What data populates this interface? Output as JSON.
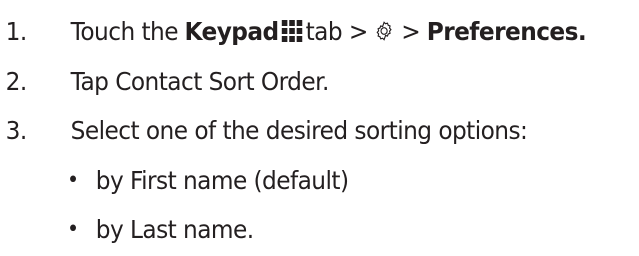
{
  "steps": [
    {
      "number": "1.",
      "parts": {
        "a": "Touch the",
        "b": "Keypad",
        "c": "tab >",
        "d": ">",
        "e": "Preferences."
      }
    },
    {
      "number": "2.",
      "text": "Tap Contact Sort Order."
    },
    {
      "number": "3.",
      "text": "Select one of the desired sorting options:"
    }
  ],
  "options": [
    {
      "bullet": "•",
      "text": "by First name (default)"
    },
    {
      "bullet": "•",
      "text": "by Last name."
    }
  ],
  "icons": {
    "keypad": "keypad-grid-icon",
    "settings": "gear-icon"
  },
  "colors": {
    "text": "#231f20"
  }
}
